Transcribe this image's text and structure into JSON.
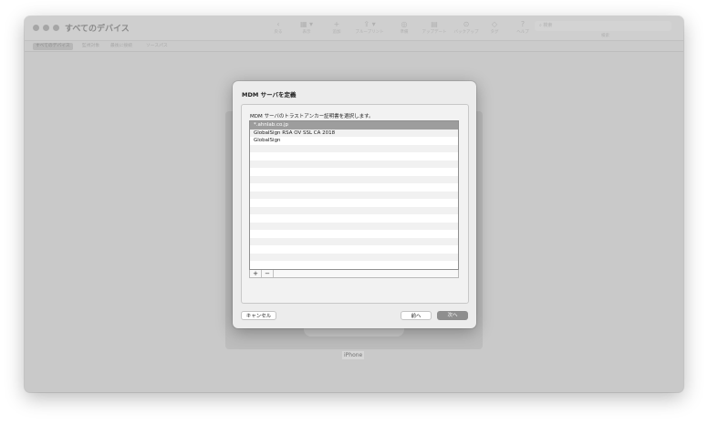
{
  "window": {
    "title": "すべてのデバイス",
    "toolbar": [
      {
        "icon": "‹",
        "label": "戻る"
      },
      {
        "icon": "▦ ▾",
        "label": "表示"
      },
      {
        "icon": "+",
        "label": "追加"
      },
      {
        "icon": "⇪ ▾",
        "label": "ブループリント"
      },
      {
        "icon": "◎",
        "label": "準備"
      },
      {
        "icon": "▤",
        "label": "アップデート"
      },
      {
        "icon": "⊙",
        "label": "バックアップ"
      },
      {
        "icon": "◇",
        "label": "タグ"
      },
      {
        "icon": "?",
        "label": "ヘルプ"
      }
    ],
    "search": {
      "placeholder": "検索",
      "label": "検索"
    },
    "tabs": [
      "すべてのデバイス",
      "監視対象",
      "最後に接続",
      "ソースパス"
    ]
  },
  "device": {
    "name": "iPhone"
  },
  "dialog": {
    "title": "MDM サーバを定義",
    "instruction": "MDM サーバのトラストアンカー証明書を選択します。",
    "certificates": [
      "*.ahnlab.co.jp",
      "GlobalSign RSA OV SSL CA 2018",
      "GlobalSign"
    ],
    "selected_index": 0,
    "add_label": "+",
    "remove_label": "−",
    "buttons": {
      "cancel": "キャンセル",
      "back": "前へ",
      "next": "次へ"
    }
  }
}
